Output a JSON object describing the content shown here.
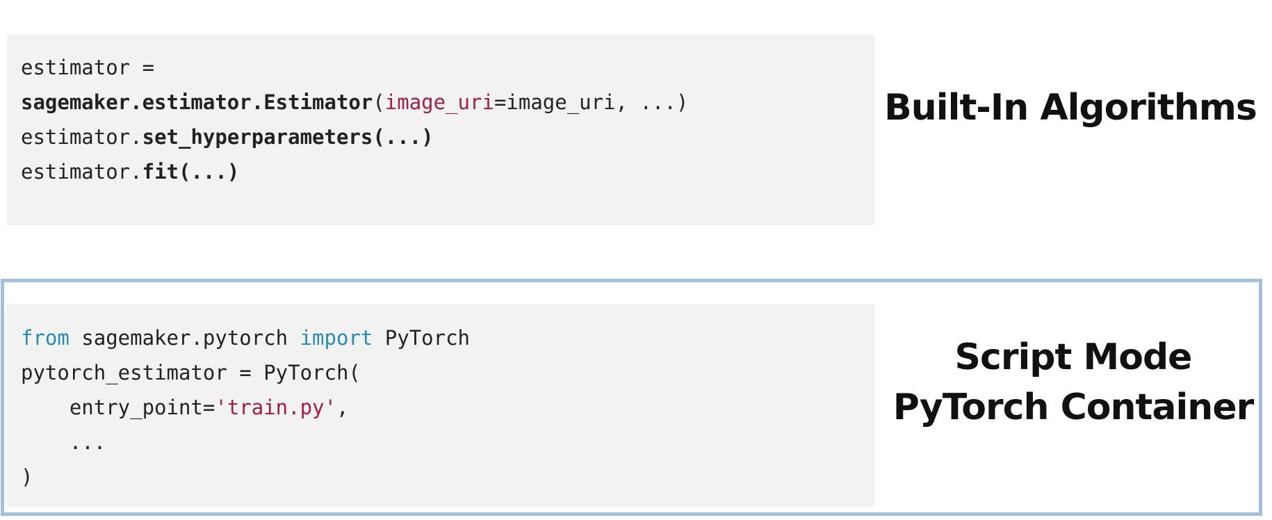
{
  "built_in": {
    "code": {
      "line1": {
        "text": "estimator ="
      },
      "line2": {
        "call": "sagemaker.estimator.Estimator",
        "open": "(",
        "param": "image_uri",
        "rest": "=image_uri, ...)"
      },
      "line3": {
        "obj": "estimator.",
        "method": "set_hyperparameters(...)"
      },
      "line4": {
        "obj": "estimator.",
        "method": "fit(...)"
      }
    },
    "label": "Built-In Algorithms"
  },
  "script_mode": {
    "code": {
      "line1": {
        "kw_from": "from",
        "module": " sagemaker.pytorch ",
        "kw_import": "import",
        "name": " PyTorch"
      },
      "line2": {
        "text": "pytorch_estimator = PyTorch("
      },
      "line3": {
        "indent": "    entry_point=",
        "value": "'train.py'",
        "tail": ","
      },
      "line4": {
        "text": "    ..."
      },
      "line5": {
        "text": ")"
      }
    },
    "label_line1": "Script Mode",
    "label_line2": "PyTorch Container"
  },
  "colors": {
    "code_background": "#f2f2f2",
    "keyword": "#2a8bb0",
    "parameter": "#a11d44",
    "highlight_border": "#a4bfdb"
  }
}
